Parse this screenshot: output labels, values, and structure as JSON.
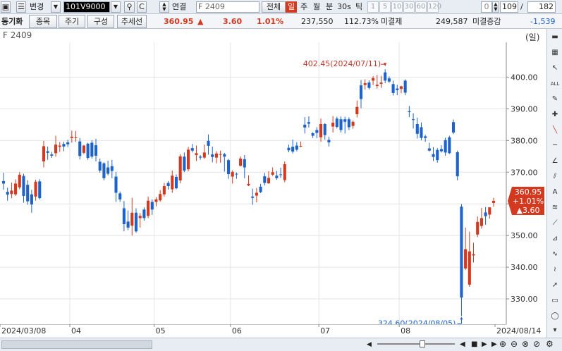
{
  "toolbar": {
    "code_value": "101V9000",
    "link_label": "연결",
    "product_name": "F 2409",
    "all_label": "전체",
    "period_tabs": [
      "일",
      "주",
      "월",
      "분",
      "30s",
      "틱"
    ],
    "minute_options": [
      "1",
      "5",
      "10",
      "30",
      "60",
      "120"
    ],
    "zero_value": "0",
    "count_value": "109",
    "total_value": "182",
    "change_label": "변경"
  },
  "toolbar2": {
    "section_label": "동기화",
    "tabs": [
      "종목",
      "주기",
      "구성",
      "추세선"
    ],
    "price": "360.95",
    "change": "3.60",
    "change_pct": "1.01%",
    "volume": "237,550",
    "volume_pct": "112.73%",
    "unsettled_label": "미결제",
    "unsettled_value": "249,587",
    "unsettled_change_label": "미결증감",
    "unsettled_change_value": "-1,539"
  },
  "title": {
    "name": "F 2409",
    "scale_label": "(일)"
  },
  "colors": {
    "up": "#d2391f",
    "down": "#1d63c9",
    "price_box": "#d2391f",
    "annotation": "#c0392b",
    "annotation_low": "#1d63c9"
  },
  "chart_data": {
    "type": "candlestick",
    "ylim": [
      322,
      411
    ],
    "yticks": [
      330,
      340,
      350,
      360,
      370,
      380,
      390,
      400
    ],
    "ytick_labels": [
      "330.00",
      "340.00",
      "350.00",
      "360.00",
      "370.00",
      "380.00",
      "390.00",
      "400.00"
    ],
    "xtick_labels": [
      "2024/03/08",
      "04",
      "05",
      "06",
      "07",
      "08",
      "2024/08/14"
    ],
    "last_price_box": [
      "360.95",
      "+1.01%",
      "▲3.60"
    ],
    "high_annotation": "402.45(2024/07/11)",
    "low_annotation": "324.60(2024/08/05)",
    "candles": [
      {
        "o": 367.2,
        "h": 369.8,
        "c": 366.4,
        "l": 364.5
      },
      {
        "o": 363.8,
        "h": 365.1,
        "c": 362.9,
        "l": 361.0
      },
      {
        "o": 363.1,
        "h": 366.7,
        "c": 364.2,
        "l": 361.8
      },
      {
        "o": 363.0,
        "h": 367.7,
        "c": 366.4,
        "l": 362.5
      },
      {
        "o": 365.2,
        "h": 370.0,
        "c": 369.2,
        "l": 364.6
      },
      {
        "o": 368.8,
        "h": 369.5,
        "c": 362.5,
        "l": 360.4
      },
      {
        "o": 366.0,
        "h": 367.5,
        "c": 360.8,
        "l": 359.7
      },
      {
        "o": 363.0,
        "h": 364.4,
        "c": 359.8,
        "l": 357.2
      },
      {
        "o": 362.3,
        "h": 367.6,
        "c": 367.0,
        "l": 361.0
      },
      {
        "o": 367.1,
        "h": 367.8,
        "c": 361.8,
        "l": 361.4
      },
      {
        "o": 373.4,
        "h": 379.9,
        "c": 378.2,
        "l": 371.5
      },
      {
        "o": 376.6,
        "h": 378.1,
        "c": 376.1,
        "l": 373.9
      },
      {
        "o": 375.6,
        "h": 376.4,
        "c": 375.2,
        "l": 374.5
      },
      {
        "o": 376.0,
        "h": 381.5,
        "c": 378.7,
        "l": 374.9
      },
      {
        "o": 378.0,
        "h": 379.5,
        "c": 378.4,
        "l": 376.4
      },
      {
        "o": 378.9,
        "h": 379.6,
        "c": 378.1,
        "l": 376.6
      },
      {
        "o": 379.4,
        "h": 380.2,
        "c": 378.8,
        "l": 377.9
      },
      {
        "o": 380.8,
        "h": 383.1,
        "c": 381.2,
        "l": 379.3
      },
      {
        "o": 380.9,
        "h": 383.0,
        "c": 381.0,
        "l": 379.6
      },
      {
        "o": 379.7,
        "h": 380.8,
        "c": 375.1,
        "l": 374.0
      },
      {
        "o": 376.1,
        "h": 378.6,
        "c": 378.4,
        "l": 375.7
      },
      {
        "o": 379.0,
        "h": 379.3,
        "c": 374.5,
        "l": 373.9
      },
      {
        "o": 379.3,
        "h": 380.1,
        "c": 374.9,
        "l": 374.3
      },
      {
        "o": 378.5,
        "h": 380.5,
        "c": 375.2,
        "l": 373.4
      },
      {
        "o": 373.3,
        "h": 374.3,
        "c": 370.5,
        "l": 369.8
      },
      {
        "o": 372.8,
        "h": 373.1,
        "c": 368.1,
        "l": 367.4
      },
      {
        "o": 371.5,
        "h": 373.6,
        "c": 369.5,
        "l": 369.0
      },
      {
        "o": 371.9,
        "h": 373.9,
        "c": 370.4,
        "l": 368.1
      },
      {
        "o": 368.6,
        "h": 370.1,
        "c": 363.5,
        "l": 360.6
      },
      {
        "o": 363.3,
        "h": 363.9,
        "c": 361.4,
        "l": 360.6
      },
      {
        "o": 358.6,
        "h": 360.9,
        "c": 353.6,
        "l": 351.3
      },
      {
        "o": 354.4,
        "h": 357.9,
        "c": 352.5,
        "l": 351.7
      },
      {
        "o": 353.1,
        "h": 361.9,
        "c": 357.2,
        "l": 350.0
      },
      {
        "o": 357.2,
        "h": 358.6,
        "c": 351.3,
        "l": 350.9
      },
      {
        "o": 355.5,
        "h": 357.1,
        "c": 356.2,
        "l": 352.5
      },
      {
        "o": 358.2,
        "h": 358.9,
        "c": 355.5,
        "l": 354.7
      },
      {
        "o": 356.2,
        "h": 362.3,
        "c": 361.0,
        "l": 355.5
      },
      {
        "o": 360.6,
        "h": 361.4,
        "c": 358.2,
        "l": 356.5
      },
      {
        "o": 360.6,
        "h": 362.1,
        "c": 361.4,
        "l": 359.2
      },
      {
        "o": 361.1,
        "h": 364.3,
        "c": 363.1,
        "l": 360.7
      },
      {
        "o": 363.0,
        "h": 366.6,
        "c": 365.6,
        "l": 362.3
      },
      {
        "o": 366.6,
        "h": 367.2,
        "c": 365.6,
        "l": 364.5
      },
      {
        "o": 364.6,
        "h": 370.5,
        "c": 368.9,
        "l": 363.5
      },
      {
        "o": 368.5,
        "h": 369.3,
        "c": 364.9,
        "l": 364.6
      },
      {
        "o": 367.4,
        "h": 375.7,
        "c": 375.0,
        "l": 366.5
      },
      {
        "o": 374.9,
        "h": 376.2,
        "c": 370.5,
        "l": 370.0
      },
      {
        "o": 370.9,
        "h": 378.0,
        "c": 377.1,
        "l": 370.3
      },
      {
        "o": 377.6,
        "h": 378.9,
        "c": 376.8,
        "l": 376.2
      },
      {
        "o": 375.4,
        "h": 378.4,
        "c": 376.0,
        "l": 373.5
      },
      {
        "o": 374.9,
        "h": 375.4,
        "c": 374.6,
        "l": 373.9
      },
      {
        "o": 374.6,
        "h": 378.7,
        "c": 376.2,
        "l": 374.2
      },
      {
        "o": 379.9,
        "h": 381.9,
        "c": 378.3,
        "l": 375.5
      },
      {
        "o": 375.6,
        "h": 378.1,
        "c": 374.8,
        "l": 373.1
      },
      {
        "o": 374.6,
        "h": 376.6,
        "c": 375.9,
        "l": 372.8
      },
      {
        "o": 375.5,
        "h": 376.8,
        "c": 375.7,
        "l": 373.0
      },
      {
        "o": 375.7,
        "h": 376.1,
        "c": 374.9,
        "l": 370.2
      },
      {
        "o": 373.8,
        "h": 374.2,
        "c": 369.4,
        "l": 367.9
      },
      {
        "o": 368.6,
        "h": 370.6,
        "c": 370.1,
        "l": 366.4
      },
      {
        "o": 369.5,
        "h": 369.9,
        "c": 369.3,
        "l": 367.9
      },
      {
        "o": 372.0,
        "h": 375.0,
        "c": 374.3,
        "l": 371.8
      },
      {
        "o": 374.1,
        "h": 375.4,
        "c": 371.5,
        "l": 368.1
      },
      {
        "o": 365.8,
        "h": 369.0,
        "c": 366.3,
        "l": 365.6
      },
      {
        "o": 362.3,
        "h": 364.8,
        "c": 361.9,
        "l": 359.7
      },
      {
        "o": 362.6,
        "h": 365.0,
        "c": 363.5,
        "l": 360.5
      },
      {
        "o": 365.4,
        "h": 366.3,
        "c": 363.7,
        "l": 363.4
      },
      {
        "o": 368.7,
        "h": 369.8,
        "c": 366.6,
        "l": 365.8
      },
      {
        "o": 366.5,
        "h": 370.3,
        "c": 368.2,
        "l": 366.3
      },
      {
        "o": 369.2,
        "h": 371.5,
        "c": 370.0,
        "l": 368.8
      },
      {
        "o": 368.9,
        "h": 370.4,
        "c": 368.1,
        "l": 367.6
      },
      {
        "o": 369.3,
        "h": 371.4,
        "c": 369.2,
        "l": 368.2
      },
      {
        "o": 367.5,
        "h": 373.4,
        "c": 372.5,
        "l": 366.8
      },
      {
        "o": 377.7,
        "h": 378.7,
        "c": 376.9,
        "l": 376.3
      },
      {
        "o": 378.0,
        "h": 380.3,
        "c": 376.5,
        "l": 375.9
      },
      {
        "o": 378.4,
        "h": 379.5,
        "c": 377.1,
        "l": 376.6
      },
      {
        "o": 378.1,
        "h": 379.7,
        "c": 378.3,
        "l": 377.9
      },
      {
        "o": 385.0,
        "h": 387.4,
        "c": 384.1,
        "l": 382.2
      },
      {
        "o": 385.8,
        "h": 387.6,
        "c": 385.3,
        "l": 384.1
      },
      {
        "o": 382.3,
        "h": 382.6,
        "c": 381.5,
        "l": 380.8
      },
      {
        "o": 383.3,
        "h": 384.2,
        "c": 382.4,
        "l": 380.7
      },
      {
        "o": 381.0,
        "h": 386.9,
        "c": 385.2,
        "l": 379.6
      },
      {
        "o": 385.2,
        "h": 385.5,
        "c": 381.7,
        "l": 380.3
      },
      {
        "o": 380.2,
        "h": 381.2,
        "c": 379.4,
        "l": 378.1
      },
      {
        "o": 384.4,
        "h": 387.7,
        "c": 385.6,
        "l": 382.5
      },
      {
        "o": 386.9,
        "h": 387.5,
        "c": 384.3,
        "l": 383.8
      },
      {
        "o": 386.7,
        "h": 387.6,
        "c": 383.3,
        "l": 382.5
      },
      {
        "o": 386.7,
        "h": 387.5,
        "c": 385.9,
        "l": 382.2
      },
      {
        "o": 386.7,
        "h": 387.3,
        "c": 384.2,
        "l": 383.3
      },
      {
        "o": 384.6,
        "h": 386.3,
        "c": 385.9,
        "l": 383.7
      },
      {
        "o": 388.3,
        "h": 392.6,
        "c": 390.6,
        "l": 387.3
      },
      {
        "o": 397.4,
        "h": 399.1,
        "c": 393.1,
        "l": 390.2
      },
      {
        "o": 397.5,
        "h": 399.3,
        "c": 398.1,
        "l": 396.1
      },
      {
        "o": 398.3,
        "h": 399.0,
        "c": 396.6,
        "l": 396.1
      },
      {
        "o": 398.9,
        "h": 400.3,
        "c": 399.7,
        "l": 397.5
      },
      {
        "o": 397.2,
        "h": 400.7,
        "c": 397.6,
        "l": 396.4
      },
      {
        "o": 397.9,
        "h": 400.4,
        "c": 398.3,
        "l": 396.6
      },
      {
        "o": 401.5,
        "h": 402.5,
        "c": 398.9,
        "l": 398.1
      },
      {
        "o": 399.6,
        "h": 400.2,
        "c": 398.6,
        "l": 398.2
      },
      {
        "o": 397.8,
        "h": 398.9,
        "c": 395.0,
        "l": 394.2
      },
      {
        "o": 396.4,
        "h": 397.6,
        "c": 395.9,
        "l": 394.3
      },
      {
        "o": 396.3,
        "h": 397.3,
        "c": 397.1,
        "l": 394.9
      },
      {
        "o": 398.9,
        "h": 399.3,
        "c": 395.1,
        "l": 394.3
      },
      {
        "o": 389.2,
        "h": 390.9,
        "c": 389.1,
        "l": 387.4
      },
      {
        "o": 386.7,
        "h": 388.6,
        "c": 386.5,
        "l": 383.8
      },
      {
        "o": 385.2,
        "h": 387.2,
        "c": 382.1,
        "l": 380.6
      },
      {
        "o": 384.2,
        "h": 385.7,
        "c": 380.8,
        "l": 380.1
      },
      {
        "o": 381.3,
        "h": 381.8,
        "c": 380.8,
        "l": 379.6
      },
      {
        "o": 377.5,
        "h": 379.3,
        "c": 376.8,
        "l": 376.5
      },
      {
        "o": 375.7,
        "h": 377.9,
        "c": 374.8,
        "l": 373.5
      },
      {
        "o": 377.0,
        "h": 377.6,
        "c": 373.8,
        "l": 373.0
      },
      {
        "o": 377.3,
        "h": 378.5,
        "c": 376.6,
        "l": 376.2
      },
      {
        "o": 380.1,
        "h": 380.9,
        "c": 376.2,
        "l": 375.2
      },
      {
        "o": 381.0,
        "h": 381.5,
        "c": 376.0,
        "l": 375.7
      },
      {
        "o": 385.8,
        "h": 386.6,
        "c": 382.5,
        "l": 382.0
      },
      {
        "o": 376.3,
        "h": 376.8,
        "c": 368.7,
        "l": 367.4
      },
      {
        "o": 359.1,
        "h": 359.9,
        "c": 330.4,
        "l": 324.6
      },
      {
        "o": 339.6,
        "h": 352.5,
        "c": 345.7,
        "l": 339.1
      },
      {
        "o": 334.5,
        "h": 351.2,
        "c": 345.0,
        "l": 333.8
      },
      {
        "o": 343.7,
        "h": 347.7,
        "c": 344.1,
        "l": 341.5
      },
      {
        "o": 350.3,
        "h": 356.0,
        "c": 354.3,
        "l": 349.5
      },
      {
        "o": 353.0,
        "h": 358.7,
        "c": 355.5,
        "l": 352.2
      },
      {
        "o": 357.3,
        "h": 359.0,
        "c": 356.1,
        "l": 353.4
      },
      {
        "o": 356.6,
        "h": 358.6,
        "c": 358.9,
        "l": 355.3
      },
      {
        "o": 360.3,
        "h": 361.9,
        "c": 360.95,
        "l": 359.1
      }
    ]
  },
  "bottom": {
    "zoom_icons": [
      "zoom-in-icon",
      "zoom-out-icon",
      "zoom-fit-icon",
      "zoom-reset-icon",
      "settings-icon"
    ]
  }
}
